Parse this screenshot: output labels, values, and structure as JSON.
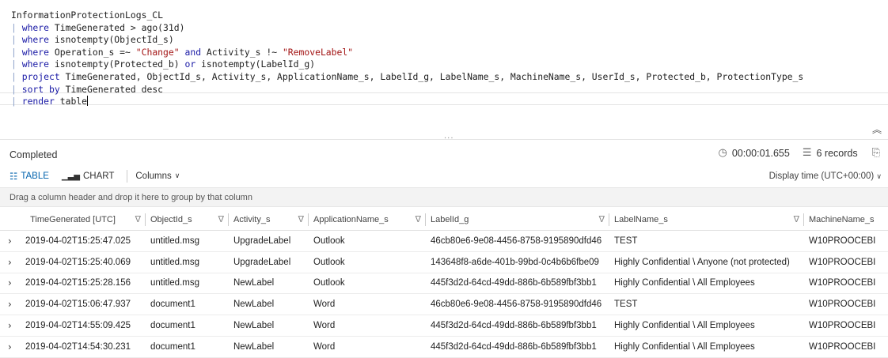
{
  "query": {
    "lines": [
      [
        {
          "t": "InformationProtectionLogs_CL",
          "c": "plain"
        }
      ],
      [
        {
          "t": "| ",
          "c": "bar"
        },
        {
          "t": "where",
          "c": "kw"
        },
        {
          "t": " TimeGenerated > ago(31d)",
          "c": "plain"
        }
      ],
      [
        {
          "t": "| ",
          "c": "bar"
        },
        {
          "t": "where",
          "c": "kw"
        },
        {
          "t": " isnotempty(ObjectId_s)",
          "c": "plain"
        }
      ],
      [
        {
          "t": "| ",
          "c": "bar"
        },
        {
          "t": "where",
          "c": "kw"
        },
        {
          "t": " Operation_s =~ ",
          "c": "plain"
        },
        {
          "t": "\"Change\"",
          "c": "str"
        },
        {
          "t": " ",
          "c": "plain"
        },
        {
          "t": "and",
          "c": "kw"
        },
        {
          "t": " Activity_s !~ ",
          "c": "plain"
        },
        {
          "t": "\"RemoveLabel\"",
          "c": "str"
        }
      ],
      [
        {
          "t": "| ",
          "c": "bar"
        },
        {
          "t": "where",
          "c": "kw"
        },
        {
          "t": " isnotempty(Protected_b) ",
          "c": "plain"
        },
        {
          "t": "or",
          "c": "kw"
        },
        {
          "t": " isnotempty(LabelId_g)",
          "c": "plain"
        }
      ],
      [
        {
          "t": "| ",
          "c": "bar"
        },
        {
          "t": "project",
          "c": "kw"
        },
        {
          "t": " TimeGenerated, ObjectId_s, Activity_s, ApplicationName_s, LabelId_g, LabelName_s, MachineName_s, UserId_s, Protected_b, ProtectionType_s",
          "c": "plain"
        }
      ],
      [
        {
          "t": "| ",
          "c": "bar"
        },
        {
          "t": "sort by",
          "c": "kw"
        },
        {
          "t": " TimeGenerated desc",
          "c": "plain"
        }
      ],
      [
        {
          "t": "| ",
          "c": "bar"
        },
        {
          "t": "render",
          "c": "kw"
        },
        {
          "t": " table",
          "c": "plain"
        }
      ]
    ]
  },
  "results": {
    "status": "Completed",
    "duration": "00:00:01.655",
    "record_count": "6 records",
    "toolbar": {
      "table_label": "TABLE",
      "chart_label": "CHART",
      "columns_label": "Columns"
    },
    "display_time": "Display time (UTC+00:00)",
    "group_hint": "Drag a column header and drop it here to group by that column",
    "columns": [
      "TimeGenerated [UTC]",
      "ObjectId_s",
      "Activity_s",
      "ApplicationName_s",
      "LabelId_g",
      "LabelName_s",
      "MachineName_s"
    ],
    "rows": [
      [
        "2019-04-02T15:25:47.025",
        "untitled.msg",
        "UpgradeLabel",
        "Outlook",
        "46cb80e6-9e08-4456-8758-9195890dfd46",
        "TEST",
        "W10PROOCEBI"
      ],
      [
        "2019-04-02T15:25:40.069",
        "untitled.msg",
        "UpgradeLabel",
        "Outlook",
        "143648f8-a6de-401b-99bd-0c4b6b6fbe09",
        "Highly Confidential \\ Anyone (not protected)",
        "W10PROOCEBI"
      ],
      [
        "2019-04-02T15:25:28.156",
        "untitled.msg",
        "NewLabel",
        "Outlook",
        "445f3d2d-64cd-49dd-886b-6b589fbf3bb1",
        "Highly Confidential \\ All Employees",
        "W10PROOCEBI"
      ],
      [
        "2019-04-02T15:06:47.937",
        "document1",
        "NewLabel",
        "Word",
        "46cb80e6-9e08-4456-8758-9195890dfd46",
        "TEST",
        "W10PROOCEBI"
      ],
      [
        "2019-04-02T14:55:09.425",
        "document1",
        "NewLabel",
        "Word",
        "445f3d2d-64cd-49dd-886b-6b589fbf3bb1",
        "Highly Confidential \\ All Employees",
        "W10PROOCEBI"
      ],
      [
        "2019-04-02T14:54:30.231",
        "document1",
        "NewLabel",
        "Word",
        "445f3d2d-64cd-49dd-886b-6b589fbf3bb1",
        "Highly Confidential \\ All Employees",
        "W10PROOCEBI"
      ]
    ]
  }
}
